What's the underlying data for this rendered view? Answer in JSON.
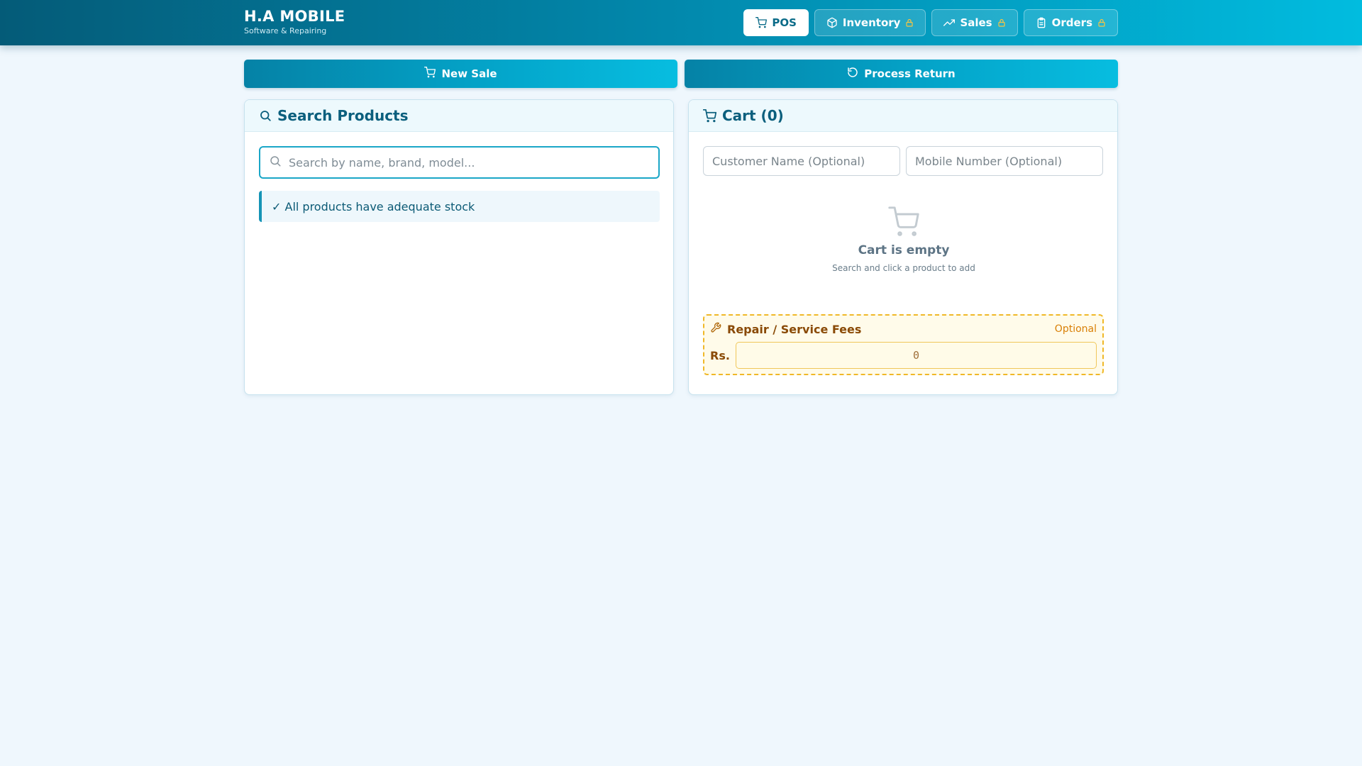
{
  "header": {
    "title": "H.A MOBILE",
    "subtitle": "Software & Repairing",
    "nav": [
      {
        "label": "POS",
        "icon": "cart-icon",
        "active": true
      },
      {
        "label": "Inventory",
        "icon": "box-icon",
        "locked": true
      },
      {
        "label": "Sales",
        "icon": "trend-up-icon",
        "locked": true
      },
      {
        "label": "Orders",
        "icon": "clipboard-icon",
        "locked": true
      }
    ]
  },
  "actions": {
    "new_sale": "New Sale",
    "process_return": "Process Return"
  },
  "search_panel": {
    "title": "Search Products",
    "placeholder": "Search by name, brand, model...",
    "stock_message": "✓ All products have adequate stock"
  },
  "cart_panel": {
    "title": "Cart (0)",
    "customer_placeholder": "Customer Name (Optional)",
    "mobile_placeholder": "Mobile Number (Optional)",
    "empty_title": "Cart is empty",
    "empty_hint": "Search and click a product to add",
    "fees": {
      "title": "Repair / Service Fees",
      "optional": "Optional",
      "currency": "Rs.",
      "placeholder": "0"
    }
  },
  "colors": {
    "primary": "#0289ad",
    "accent": "#01bcdf",
    "fees_border": "#f0b828",
    "lock": "#f5c542"
  }
}
